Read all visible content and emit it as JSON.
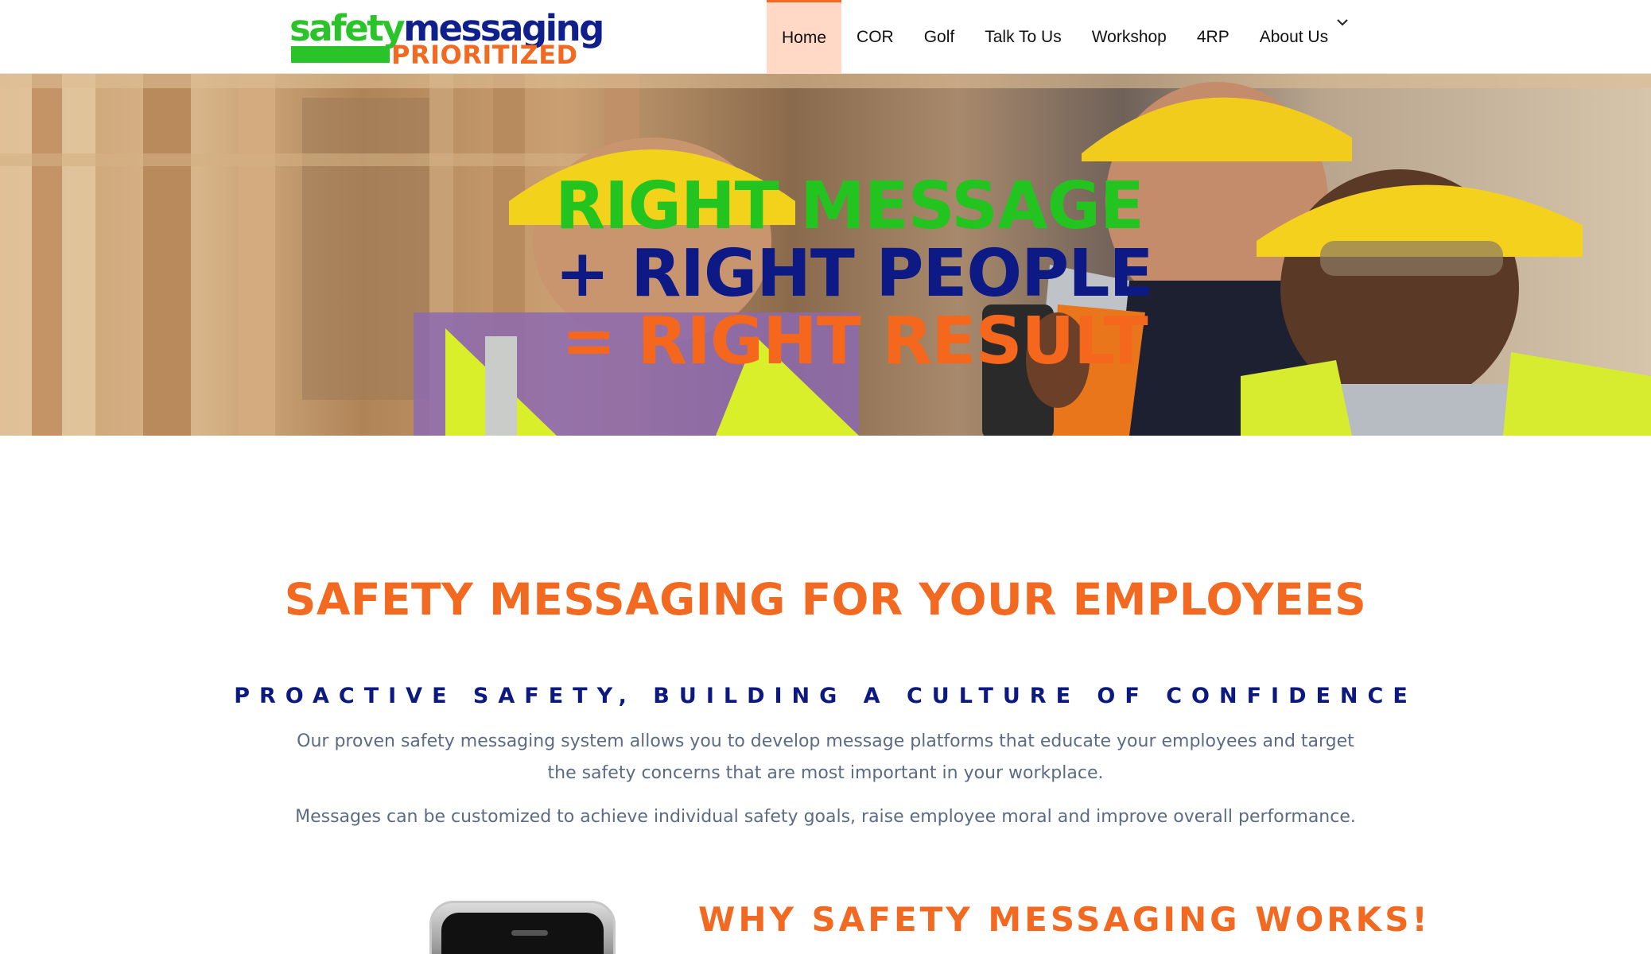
{
  "logo": {
    "top_left": "safety",
    "top_right": "messaging",
    "bottom": "PRIORITIZED"
  },
  "nav": {
    "items": [
      {
        "label": "Home",
        "active": true
      },
      {
        "label": "COR"
      },
      {
        "label": "Golf"
      },
      {
        "label": "Talk To Us"
      },
      {
        "label": "Workshop"
      },
      {
        "label": "4RP"
      },
      {
        "label": "About Us",
        "has_dropdown": true
      }
    ],
    "caret_icon": "chevron-down-icon"
  },
  "hero": {
    "line1": "RIGHT MESSAGE",
    "line2": "+ RIGHT PEOPLE",
    "line3": "= RIGHT RESULT"
  },
  "content": {
    "title": "SAFETY MESSAGING FOR YOUR EMPLOYEES",
    "subtitle": "PROACTIVE SAFETY, BUILDING A CULTURE OF CONFIDENCE",
    "paragraph1": "Our proven safety messaging system allows you to develop message platforms that educate your employees and target the safety concerns that are most important in your workplace.",
    "paragraph2": "Messages can be customized to achieve individual safety goals, raise employee moral and improve overall performance.",
    "why_title": "WHY SAFETY MESSAGING WORKS!"
  },
  "colors": {
    "brand_green": "#2ac32a",
    "brand_navy": "#0f1f8c",
    "brand_orange": "#f26a21",
    "nav_active_bg": "#ffd9c5"
  }
}
